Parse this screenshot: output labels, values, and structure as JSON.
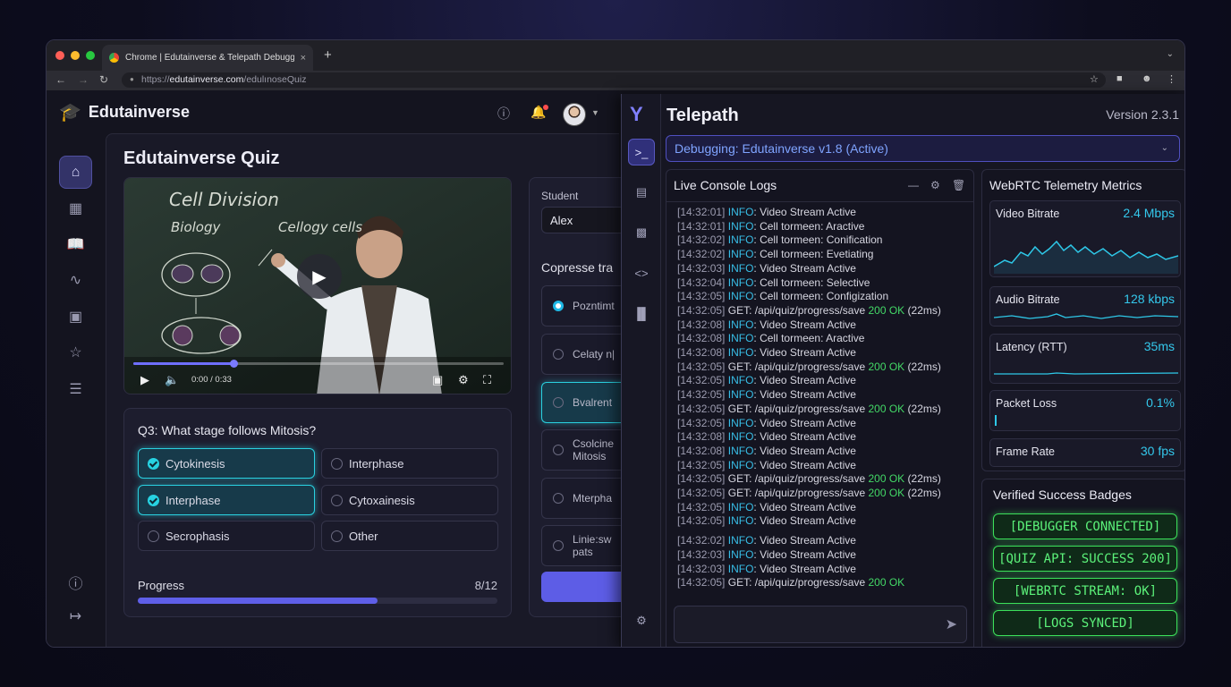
{
  "browser": {
    "tab_title": "Chrome | Edutainverse & Telepath Debugger",
    "tab_close": "×",
    "new_tab": "+",
    "url_prefix": "https://",
    "url_domain": "edutainverse.com",
    "url_path": "/edulınoseQuiz",
    "back": "←",
    "forward": "→",
    "reload": "↻",
    "colors": {
      "close": "#ff5f57",
      "min": "#febc2e",
      "max": "#28c840"
    }
  },
  "app": {
    "name": "Edutainverse",
    "icons": [
      "home-icon",
      "grid-icon",
      "book-icon",
      "activity-icon",
      "screen-icon",
      "star-icon",
      "list-icon",
      "help-icon",
      "logout-icon"
    ]
  },
  "quiz": {
    "title": "Edutainverse Quiz",
    "video": {
      "board_title": "Cell Division",
      "label_left": "Biology",
      "label_right": "Cellogy cells",
      "time": "0:00 / 0:33",
      "progress": 0.27
    },
    "question": "Q3: What stage follows Mitosis?",
    "options": [
      {
        "label": "Cytokinesis",
        "selected": true
      },
      {
        "label": "Interphase",
        "selected": false
      },
      {
        "label": "Interphase",
        "selected": true
      },
      {
        "label": "Cytoxainesis",
        "selected": false
      },
      {
        "label": "Secrophasis",
        "selected": false
      },
      {
        "label": "Other",
        "selected": false
      }
    ],
    "progress": {
      "label": "Progress",
      "count": "8/12",
      "fraction": 0.6667
    }
  },
  "side_panel": {
    "student_label": "Student",
    "student_value": "Alex",
    "compare_title": "Copresse tra",
    "alternatives": [
      {
        "line1": "Pozntimt",
        "line2": ""
      },
      {
        "line1": "Celaty n|",
        "line2": ""
      },
      {
        "line1": "Bvalrent",
        "line2": ""
      },
      {
        "line1": "Csolcine",
        "line2": "Mitosis"
      },
      {
        "line1": "Mterpha",
        "line2": ""
      },
      {
        "line1": "Linie:sw",
        "line2": "pats"
      }
    ]
  },
  "telepath": {
    "title": "Telepath",
    "version": "Version 2.3.1",
    "session": "Debugging: Edutainverse v1.8 (Active)",
    "console_title": "Live Console Logs",
    "logs": [
      {
        "ts": "[14:32:01]",
        "level": "INFO",
        "msg": ": Video Stream Active",
        "status": "",
        "rest": ""
      },
      {
        "ts": "[14:32:01]",
        "level": "INFO",
        "msg": ": Cell tormeen: Aractive",
        "status": "",
        "rest": ""
      },
      {
        "ts": "[14:32:02]",
        "level": "INFO",
        "msg": ": Cell tormeen: Conification",
        "status": "",
        "rest": ""
      },
      {
        "ts": "[14:32:02]",
        "level": "INFO",
        "msg": ": Cell tormeen: Evetiating",
        "status": "",
        "rest": ""
      },
      {
        "ts": "[14:32:03]",
        "level": "INFO",
        "msg": ": Video Stream Active",
        "status": "",
        "rest": ""
      },
      {
        "ts": "[14:32:04]",
        "level": "INFO",
        "msg": ": Cell tormeen: Selective",
        "status": "",
        "rest": ""
      },
      {
        "ts": "[14:32:05]",
        "level": "INFO",
        "msg": ": Cell tormeen: Configization",
        "status": "",
        "rest": ""
      },
      {
        "ts": "[14:32:05]",
        "level": "",
        "msg": "GET: /api/quiz/progress/save ",
        "status": "200 OK",
        "rest": " (22ms)"
      },
      {
        "ts": "[14:32:08]",
        "level": "INFO",
        "msg": ": Video Stream Active",
        "status": "",
        "rest": ""
      },
      {
        "ts": "[14:32:08]",
        "level": "INFO",
        "msg": ": Cell tormeen: Aractive",
        "status": "",
        "rest": ""
      },
      {
        "ts": "[14:32:08]",
        "level": "INFO",
        "msg": ": Video Stream Active",
        "status": "",
        "rest": ""
      },
      {
        "ts": "[14:32:05]",
        "level": "",
        "msg": "GET: /api/quiz/progress/save ",
        "status": "200 OK",
        "rest": " (22ms)"
      },
      {
        "ts": "[14:32:05]",
        "level": "INFO",
        "msg": ": Video Stream Active",
        "status": "",
        "rest": ""
      },
      {
        "ts": "[14:32:05]",
        "level": "INFO",
        "msg": ": Video Stream Active",
        "status": "",
        "rest": ""
      },
      {
        "ts": "[14:32:05]",
        "level": "",
        "msg": "GET: /api/quiz/progress/save ",
        "status": "200 OK",
        "rest": " (22ms)"
      },
      {
        "ts": "[14:32:05]",
        "level": "INFO",
        "msg": ": Video Stream Active",
        "status": "",
        "rest": ""
      },
      {
        "ts": "[14:32:08]",
        "level": "INFO",
        "msg": ": Video Stream Active",
        "status": "",
        "rest": ""
      },
      {
        "ts": "[14:32:08]",
        "level": "INFO",
        "msg": ": Video Stream Active",
        "status": "",
        "rest": ""
      },
      {
        "ts": "[14:32:05]",
        "level": "INFO",
        "msg": ": Video Stream Active",
        "status": "",
        "rest": ""
      },
      {
        "ts": "[14:32:05]",
        "level": "",
        "msg": "GET: /api/quiz/progress/save ",
        "status": "200 OK",
        "rest": " (22ms)"
      },
      {
        "ts": "[14:32:05]",
        "level": "",
        "msg": "GET: /api/quiz/progress/save ",
        "status": "200 OK",
        "rest": " (22ms)"
      },
      {
        "ts": "[14:32:05]",
        "level": "INFO",
        "msg": ": Video Stream Active",
        "status": "",
        "rest": ""
      },
      {
        "ts": "[14:32:05]",
        "level": "INFO",
        "msg": ": Video Stream Active",
        "status": "",
        "rest": ""
      },
      {
        "ts": "[14:32:02]",
        "level": "INFO",
        "msg": ": Video Stream Active",
        "status": "",
        "rest": ""
      },
      {
        "ts": "[14:32:03]",
        "level": "INFO",
        "msg": ": Video Stream Active",
        "status": "",
        "rest": ""
      },
      {
        "ts": "[14:32:03]",
        "level": "INFO",
        "msg": ": Video Stream Active",
        "status": "",
        "rest": ""
      },
      {
        "ts": "[14:32:05]",
        "level": "",
        "msg": "GET: /api/quiz/progress/save ",
        "status": "200 OK",
        "rest": ""
      }
    ],
    "metrics_title": "WebRTC Telemetry Metrics",
    "metrics": [
      {
        "label": "Video Bitrate",
        "value": "2.4 Mbps"
      },
      {
        "label": "Audio Bitrate",
        "value": "128 kbps"
      },
      {
        "label": "Latency (RTT)",
        "value": "35ms"
      },
      {
        "label": "Packet Loss",
        "value": "0.1%"
      },
      {
        "label": "Frame Rate",
        "value": "30 fps"
      }
    ],
    "badges_title": "Verified Success Badges",
    "badges": [
      "[DEBUGGER CONNECTED]",
      "[QUIZ API: SUCCESS 200]",
      "[WEBRTC STREAM: OK]",
      "[LOGS SYNCED]"
    ],
    "accent_colors": {
      "info": "#38bfe8",
      "ok": "#43d866",
      "badge": "#3ce05a"
    }
  }
}
